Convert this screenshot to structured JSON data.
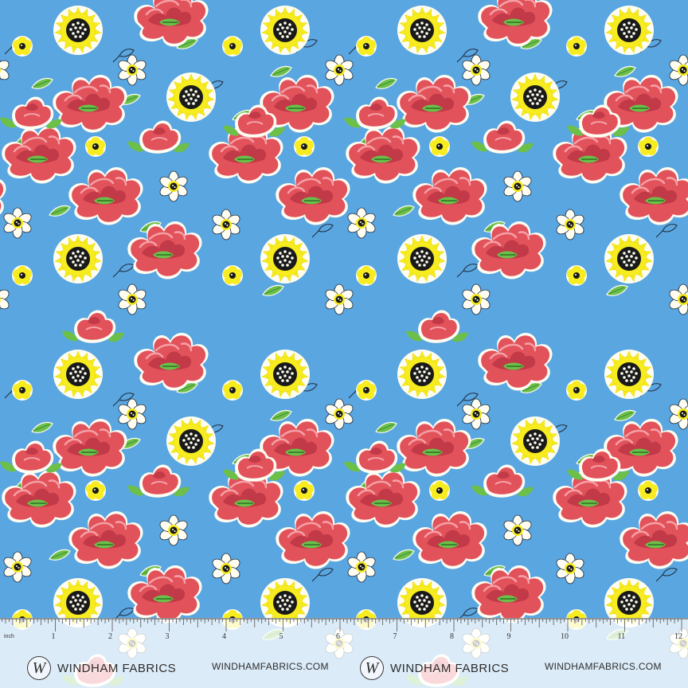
{
  "pattern": {
    "colors": {
      "background": "#5aa6e0",
      "poppy_red": "#e2525b",
      "poppy_dark": "#c23a48",
      "poppy_light": "#f08086",
      "leaf_green": "#6cc04a",
      "leaf_dark": "#3f8e2e",
      "sunflower_yellow": "#f7ec1f",
      "sunflower_outline": "#fffdf0",
      "daisy_white": "#fffdf2",
      "center_black": "#1a1a1a",
      "stem_line": "#1e2a3a"
    },
    "motifs": [
      "poppy",
      "sunflower",
      "daisy",
      "rosebud",
      "leaf-sprig"
    ]
  },
  "ruler": {
    "unit_label": "inch",
    "numbers": [
      "1",
      "2",
      "3",
      "4",
      "5",
      "6",
      "7",
      "8",
      "9",
      "10",
      "11",
      "12"
    ]
  },
  "branding": {
    "logo_letter": "W",
    "brand_name": "WINDHAM FABRICS",
    "website": "WINDHAMFABRICS.COM"
  }
}
